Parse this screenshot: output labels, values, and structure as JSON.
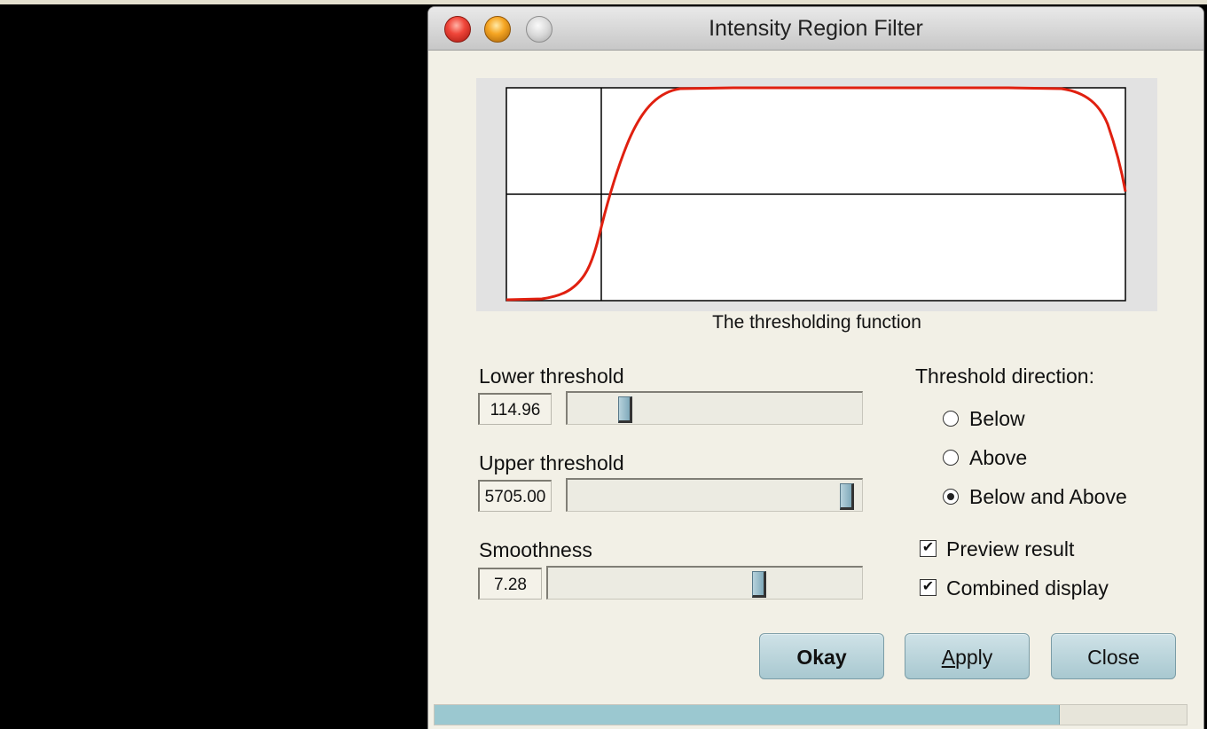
{
  "window": {
    "title": "Intensity Region Filter"
  },
  "plot": {
    "caption": "The thresholding function",
    "curve_color": "#e02010"
  },
  "lower": {
    "label": "Lower threshold",
    "value": "114.96",
    "position": 0.18
  },
  "upper": {
    "label": "Upper threshold",
    "value": "5705.00",
    "position": 0.97
  },
  "smooth": {
    "label": "Smoothness",
    "value": "7.28",
    "position": 0.68
  },
  "direction": {
    "heading": "Threshold direction:",
    "options": [
      "Below",
      "Above",
      "Below and Above"
    ],
    "selected": "Below and Above"
  },
  "checks": {
    "preview": {
      "label": "Preview result",
      "checked": true
    },
    "combined": {
      "label": "Combined display",
      "checked": true
    }
  },
  "buttons": {
    "okay": "Okay",
    "apply": "Apply",
    "close": "Close"
  },
  "progress": {
    "fraction": 0.83
  }
}
